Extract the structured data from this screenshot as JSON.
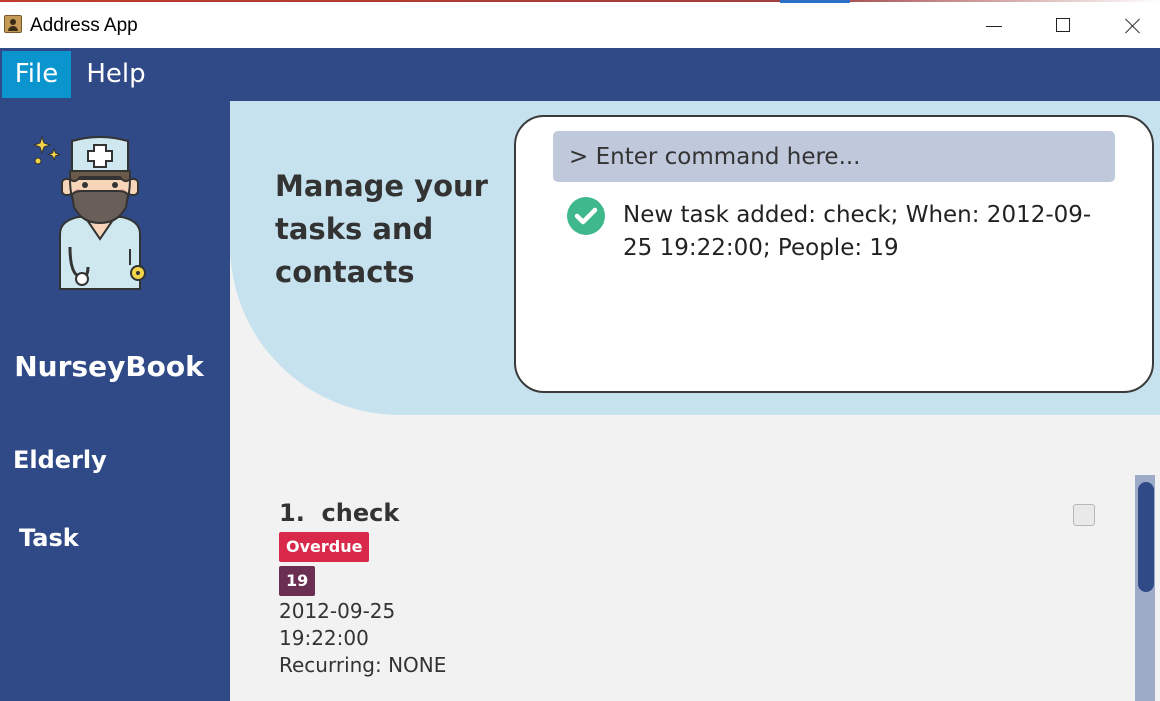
{
  "window": {
    "title": "Address App"
  },
  "menu": {
    "file": "File",
    "help": "Help"
  },
  "sidebar": {
    "brand": "NurseyBook",
    "items": [
      {
        "label": "Elderly"
      },
      {
        "label": "Task"
      }
    ]
  },
  "hero": {
    "tagline": "Manage your tasks and contacts",
    "command": {
      "placeholder": "> Enter command here...",
      "value": ""
    },
    "result": "New task added: check; When: 2012-09-25 19:22:00; People: 19",
    "result_status": "success"
  },
  "tasks": [
    {
      "index": "1.",
      "title": "check",
      "status_tag": "Overdue",
      "people_tag": "19",
      "date": "2012-09-25",
      "time": "19:22:00",
      "recurring": "Recurring: NONE",
      "done": false
    }
  ],
  "colors": {
    "primary": "#2f4a86",
    "menu_active": "#0b95cf",
    "hero": "#c5e2ee",
    "command_input": "#c0c8db",
    "success": "#3fb98c",
    "overdue": "#d9294a",
    "people_tag": "#6b2f52"
  }
}
